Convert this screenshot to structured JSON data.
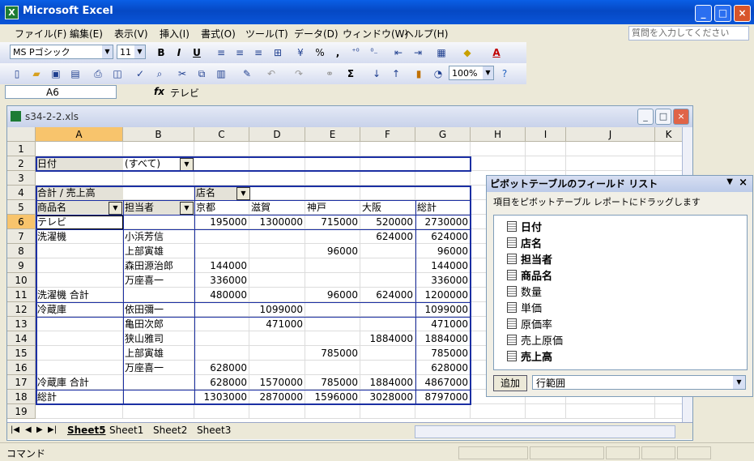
{
  "app": {
    "title": "Microsoft Excel",
    "icon": "excel-icon"
  },
  "menu": [
    "ファイル(F)",
    "編集(E)",
    "表示(V)",
    "挿入(I)",
    "書式(O)",
    "ツール(T)",
    "データ(D)",
    "ウィンドウ(W)",
    "ヘルプ(H)"
  ],
  "help_placeholder": "質問を入力してください",
  "format_toolbar": {
    "font": "MS Pゴシック",
    "size": "11",
    "bold": "B",
    "italic": "I",
    "underline": "U",
    "percent": "%",
    "comma": ","
  },
  "standard_toolbar": {
    "zoom": "100%",
    "sum": "Σ"
  },
  "formula_bar": {
    "name_box": "A6",
    "fx": "fx",
    "content": "テレビ"
  },
  "workbook": {
    "title": "s34-2-2.xls"
  },
  "columns": [
    "A",
    "B",
    "C",
    "D",
    "E",
    "F",
    "G",
    "H",
    "I",
    "J",
    "K"
  ],
  "rows": [
    "1",
    "2",
    "3",
    "4",
    "5",
    "6",
    "7",
    "8",
    "9",
    "10",
    "11",
    "12",
    "13",
    "14",
    "15",
    "16",
    "17",
    "18",
    "19"
  ],
  "pivot": {
    "page_field": "日付",
    "page_value": "(すべて)",
    "data_label": "合計 / 売上高",
    "col_field": "店名",
    "row_field_1": "商品名",
    "row_field_2": "担当者",
    "col_headers": [
      "京都",
      "滋賀",
      "神戸",
      "大阪",
      "総計"
    ],
    "rows": [
      {
        "a": "テレビ",
        "b": "",
        "v": [
          "195000",
          "1300000",
          "715000",
          "520000",
          "2730000"
        ]
      },
      {
        "a": "洗濯機",
        "b": "小浜芳信",
        "v": [
          "",
          "",
          "",
          "624000",
          "624000"
        ]
      },
      {
        "a": "",
        "b": "上部寅雄",
        "v": [
          "",
          "",
          "96000",
          "",
          "96000"
        ]
      },
      {
        "a": "",
        "b": "森田源治郎",
        "v": [
          "144000",
          "",
          "",
          "",
          "144000"
        ]
      },
      {
        "a": "",
        "b": "万座喜一",
        "v": [
          "336000",
          "",
          "",
          "",
          "336000"
        ]
      },
      {
        "a": "洗濯機 合計",
        "b": "",
        "v": [
          "480000",
          "",
          "96000",
          "624000",
          "1200000"
        ]
      },
      {
        "a": "冷蔵庫",
        "b": "依田彌一",
        "v": [
          "",
          "1099000",
          "",
          "",
          "1099000"
        ]
      },
      {
        "a": "",
        "b": "亀田次郎",
        "v": [
          "",
          "471000",
          "",
          "",
          "471000"
        ]
      },
      {
        "a": "",
        "b": "狭山雅司",
        "v": [
          "",
          "",
          "",
          "1884000",
          "1884000"
        ]
      },
      {
        "a": "",
        "b": "上部寅雄",
        "v": [
          "",
          "",
          "785000",
          "",
          "785000"
        ]
      },
      {
        "a": "",
        "b": "万座喜一",
        "v": [
          "628000",
          "",
          "",
          "",
          "628000"
        ]
      },
      {
        "a": "冷蔵庫 合計",
        "b": "",
        "v": [
          "628000",
          "1570000",
          "785000",
          "1884000",
          "4867000"
        ]
      },
      {
        "a": "総計",
        "b": "",
        "v": [
          "1303000",
          "2870000",
          "1596000",
          "3028000",
          "8797000"
        ]
      }
    ]
  },
  "sheet_tabs": [
    "Sheet5",
    "Sheet1",
    "Sheet2",
    "Sheet3"
  ],
  "field_list": {
    "title": "ピボットテーブルのフィールド リスト",
    "hint": "項目をピボットテーブル レポートにドラッグします",
    "fields": [
      {
        "name": "日付",
        "bold": true
      },
      {
        "name": "店名",
        "bold": true
      },
      {
        "name": "担当者",
        "bold": true
      },
      {
        "name": "商品名",
        "bold": true
      },
      {
        "name": "数量",
        "bold": false
      },
      {
        "name": "単価",
        "bold": false
      },
      {
        "name": "原価率",
        "bold": false
      },
      {
        "name": "売上原価",
        "bold": false
      },
      {
        "name": "売上高",
        "bold": true
      }
    ],
    "add_button": "追加",
    "area": "行範囲"
  },
  "status": "コマンド"
}
